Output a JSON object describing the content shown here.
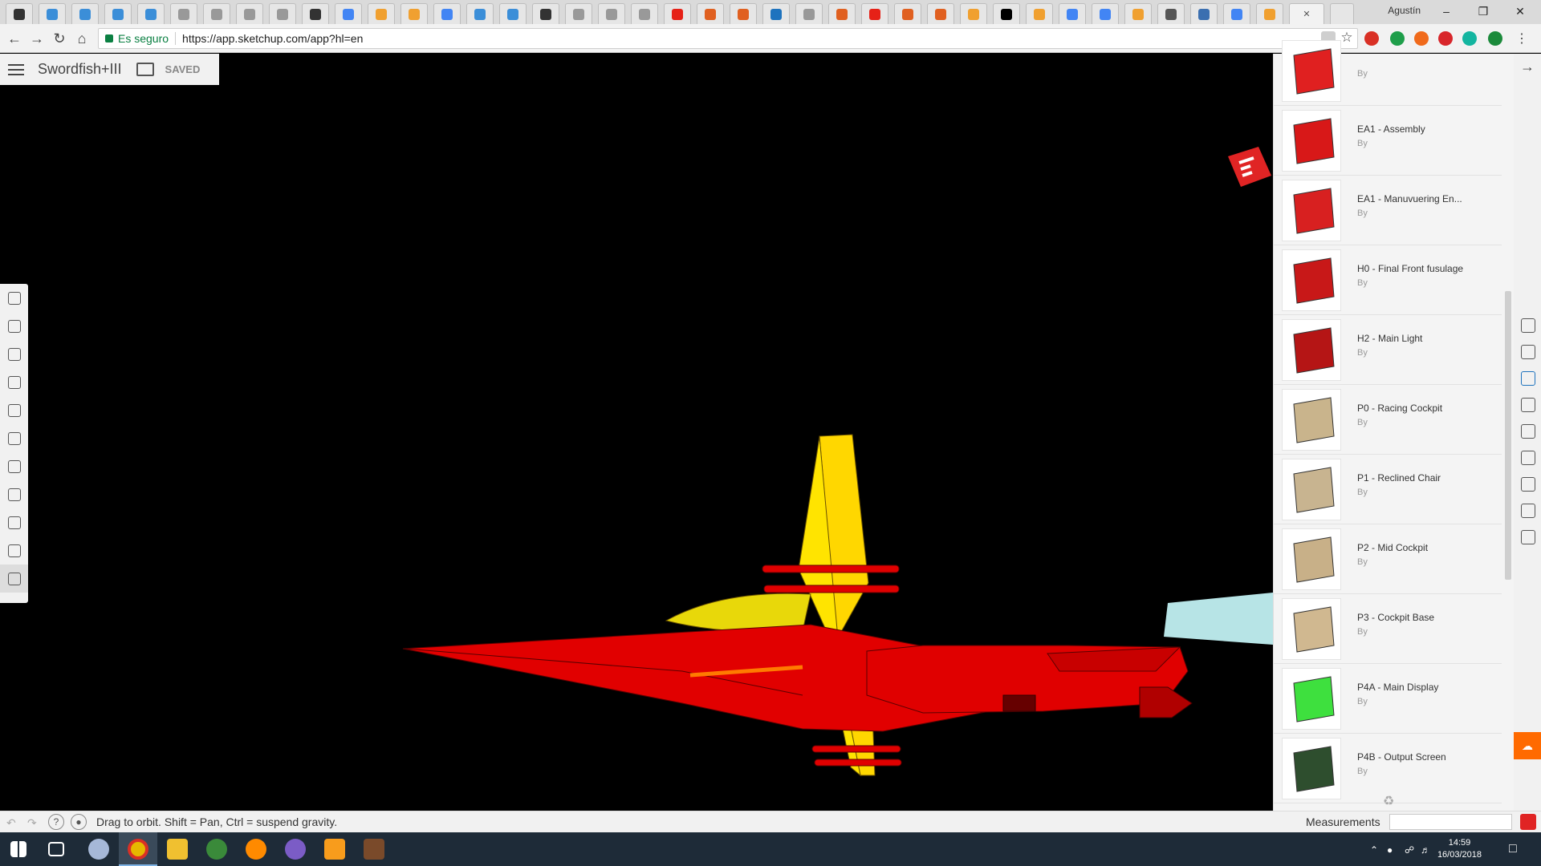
{
  "browser": {
    "user": "Agustín",
    "secure_label": "Es seguro",
    "url": "https://app.sketchup.com/app?hl=en"
  },
  "app": {
    "model_name": "Swordfish+III",
    "save_status": "SAVED"
  },
  "components": [
    {
      "name": "",
      "by": "By",
      "color": "#e02020"
    },
    {
      "name": "EA1 - Assembly",
      "by": "By",
      "color": "#d81818"
    },
    {
      "name": "EA1 - Manuvuering En...",
      "by": "By",
      "color": "#d82020"
    },
    {
      "name": "H0 - Final Front fusulage",
      "by": "By",
      "color": "#c81818"
    },
    {
      "name": "H2 - Main Light",
      "by": "By",
      "color": "#b51515"
    },
    {
      "name": "P0 - Racing Cockpit",
      "by": "By",
      "color": "#c9b48c"
    },
    {
      "name": "P1 - Reclined Chair",
      "by": "By",
      "color": "#c8b490"
    },
    {
      "name": "P2 - Mid Cockpit",
      "by": "By",
      "color": "#c8b088"
    },
    {
      "name": "P3 - Cockpit Base",
      "by": "By",
      "color": "#d0b890"
    },
    {
      "name": "P4A - Main Display",
      "by": "By",
      "color": "#3ee03e"
    },
    {
      "name": "P4B - Output Screen",
      "by": "By",
      "color": "#2e4e2e"
    }
  ],
  "status": {
    "hint": "Drag to orbit. Shift = Pan, Ctrl = suspend gravity.",
    "measurements_label": "Measurements",
    "measurements_value": ""
  },
  "taskbar": {
    "time": "14:59",
    "date": "16/03/2018"
  }
}
